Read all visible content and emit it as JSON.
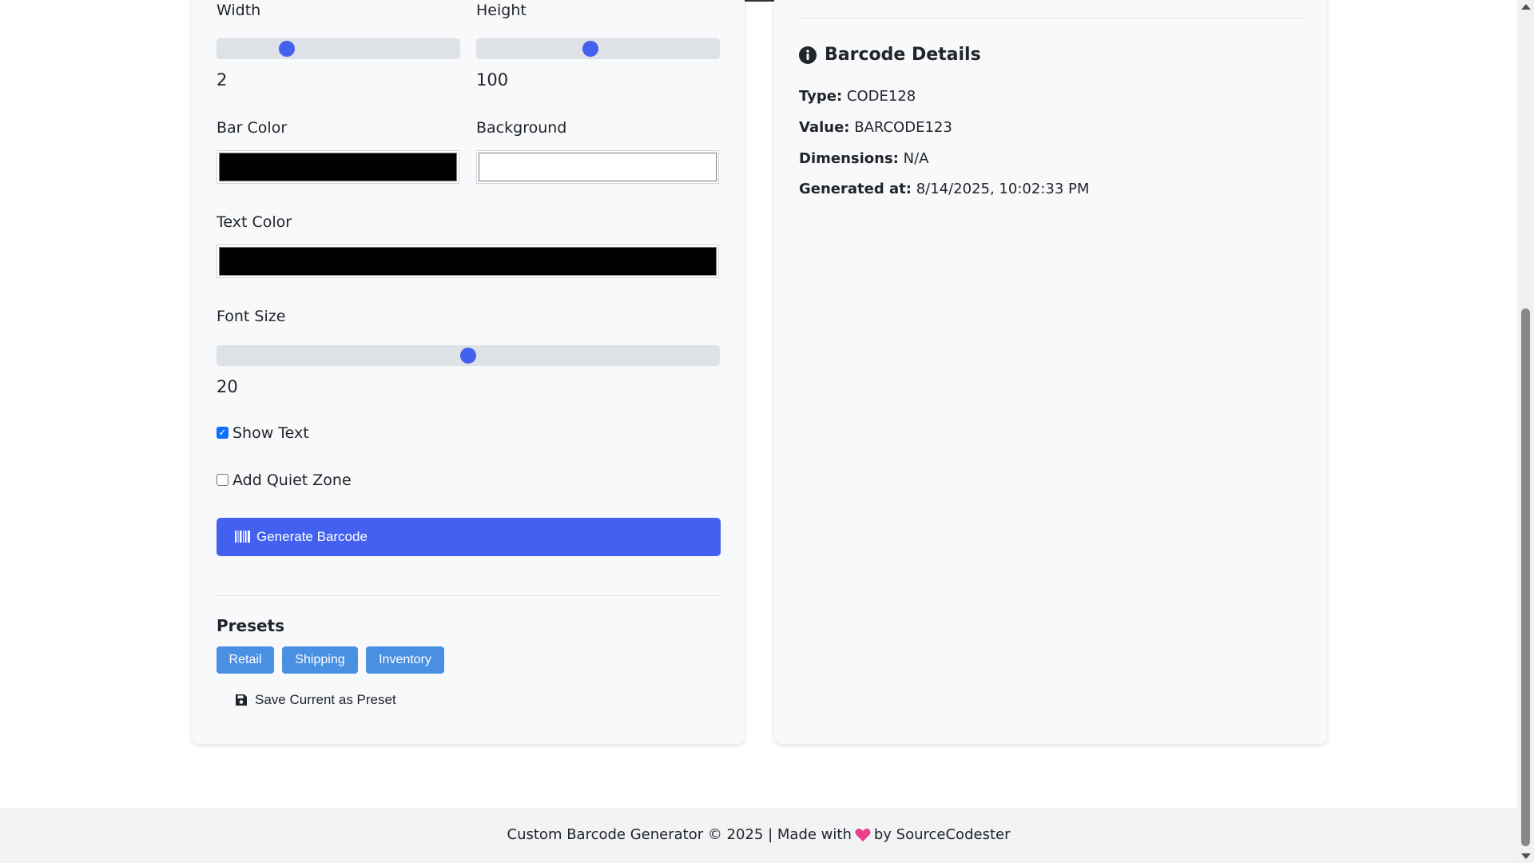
{
  "controls": {
    "width": {
      "label": "Width",
      "value": "2",
      "fraction": 0.29
    },
    "height": {
      "label": "Height",
      "value": "100",
      "fraction": 0.47
    },
    "bar_color": {
      "label": "Bar Color",
      "color": "#000000"
    },
    "background": {
      "label": "Background",
      "color": "#ffffff"
    },
    "text_color": {
      "label": "Text Color",
      "color": "#000000"
    },
    "font_size": {
      "label": "Font Size",
      "value": "20",
      "fraction": 0.5
    },
    "show_text": {
      "label": "Show Text",
      "checked": true
    },
    "quiet_zone": {
      "label": "Add Quiet Zone",
      "checked": false
    },
    "generate_label": "Generate Barcode"
  },
  "presets": {
    "title": "Presets",
    "items": [
      "Retail",
      "Shipping",
      "Inventory"
    ],
    "save_label": "Save Current as Preset"
  },
  "details": {
    "title": "Barcode Details",
    "type_label": "Type:",
    "type_value": "CODE128",
    "value_label": "Value:",
    "value_value": "BARCODE123",
    "dimensions_label": "Dimensions:",
    "dimensions_value": "N/A",
    "generated_label": "Generated at:",
    "generated_value": "8/14/2025, 10:02:33 PM"
  },
  "footer": {
    "prefix": "Custom Barcode Generator © 2025 | Made with",
    "suffix": "by SourceCodester"
  },
  "colors": {
    "accent": "#4361ee",
    "preset": "#4a90e2",
    "heart": "#e83e8c"
  },
  "icons": {
    "barcode": "barcode-icon",
    "save": "floppy-disk-icon",
    "info": "info-circle-icon",
    "heart": "heart-icon"
  }
}
